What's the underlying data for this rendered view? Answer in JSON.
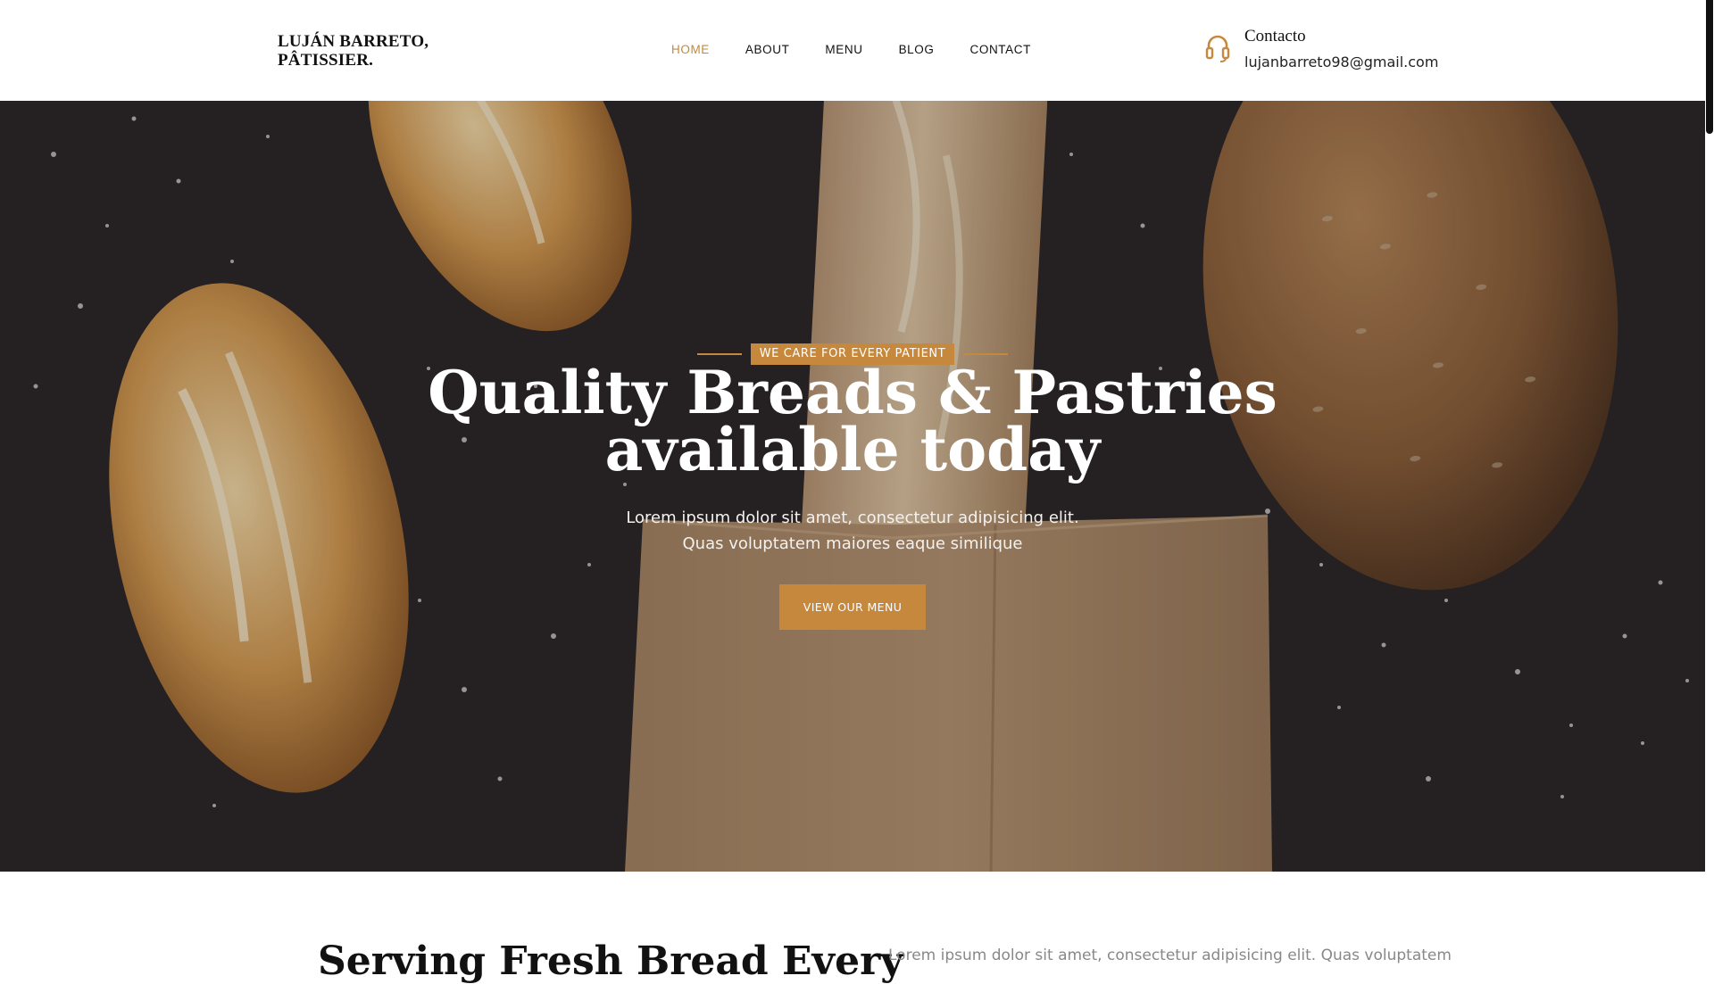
{
  "header": {
    "logo_line1": "LUJÁN BARRETO,",
    "logo_line2": "PÂTISSIER.",
    "nav": [
      {
        "label": "HOME",
        "active": true
      },
      {
        "label": "ABOUT",
        "active": false
      },
      {
        "label": "MENU",
        "active": false
      },
      {
        "label": "BLOG",
        "active": false
      },
      {
        "label": "CONTACT",
        "active": false
      }
    ],
    "contact": {
      "icon": "headset-icon",
      "title": "Contacto",
      "email": "lujanbarreto98@gmail.com"
    }
  },
  "hero": {
    "tagline": "WE CARE FOR EVERY PATIENT",
    "title_line1": "Quality Breads & Pastries",
    "title_line2": "available today",
    "subtitle_line1": "Lorem ipsum dolor sit amet, consectetur adipisicing elit.",
    "subtitle_line2": "Quas voluptatem maiores eaque similique",
    "button_label": "VIEW OUR MENU"
  },
  "section": {
    "title": "Serving Fresh Bread Every",
    "text": "Lorem ipsum dolor sit amet, consectetur adipisicing elit. Quas voluptatem"
  },
  "colors": {
    "accent": "#c6883c",
    "hero_bg": "#2b2628",
    "text_dark": "#111111"
  }
}
